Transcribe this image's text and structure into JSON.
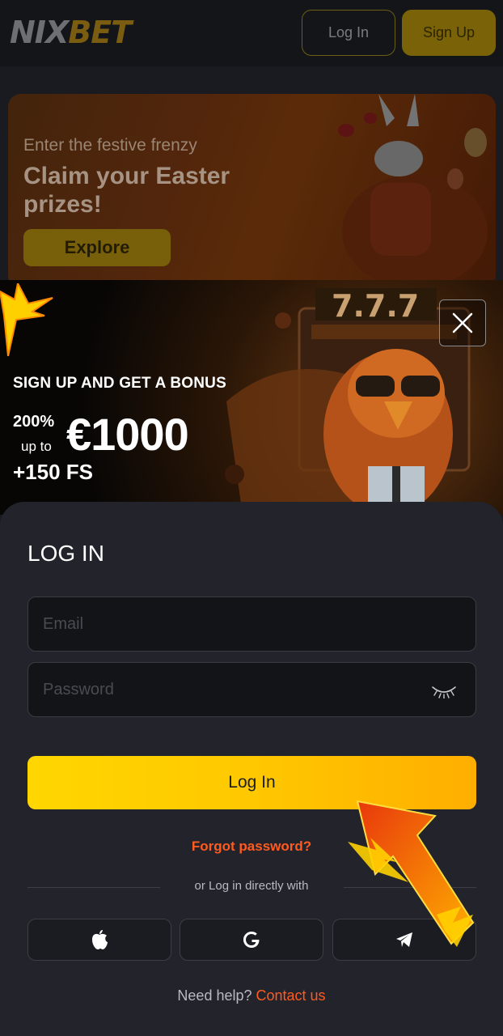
{
  "header": {
    "logo_left": "NIX",
    "logo_right": "BET",
    "login_label": "Log In",
    "signup_label": "Sign Up"
  },
  "promo": {
    "subtitle": "Enter the festive frenzy",
    "title": "Claim your Easter prizes!",
    "button": "Explore"
  },
  "bonus": {
    "headline": "SIGN UP AND GET A BONUS",
    "percent": "200%",
    "up_to": "up to",
    "amount": "€1000",
    "free_spins": "+150 FS"
  },
  "login_form": {
    "title": "LOG IN",
    "email_placeholder": "Email",
    "password_placeholder": "Password",
    "submit_label": "Log In",
    "forgot_label": "Forgot password?",
    "social_prompt": "or Log in directly with",
    "social_providers": [
      "apple-icon",
      "google-icon",
      "telegram-icon"
    ],
    "help_text": "Need help?",
    "contact_label": "Contact us"
  },
  "colors": {
    "accent_yellow": "#ffd600",
    "accent_orange": "#ff5a1f",
    "panel_bg": "#23242b"
  }
}
